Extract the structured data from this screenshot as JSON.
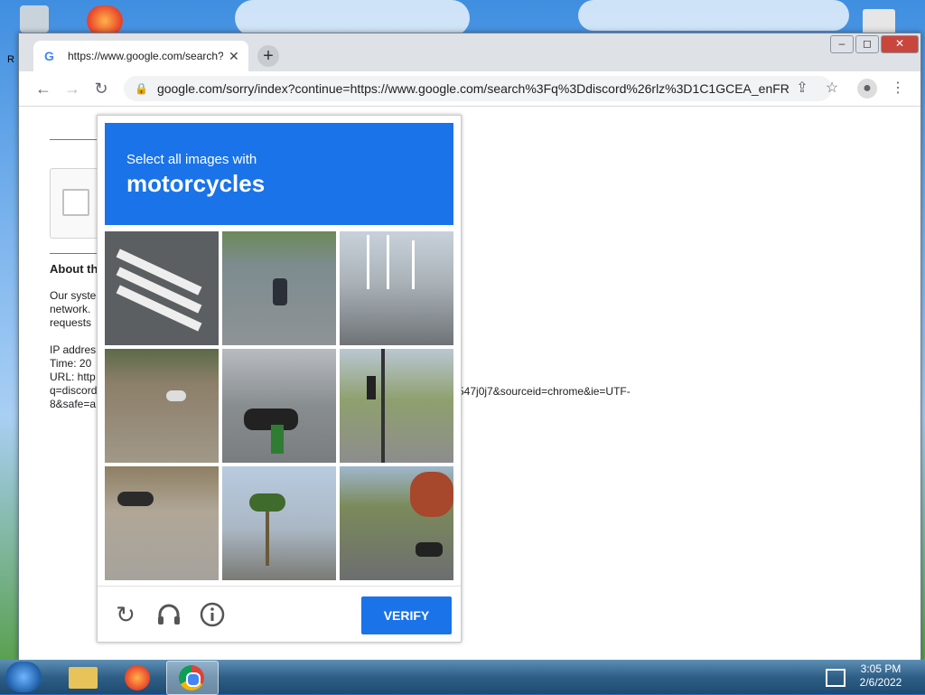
{
  "desktop": {
    "recycle_label": "R"
  },
  "browser": {
    "tab": {
      "title": "https://www.google.com/search?"
    },
    "new_tab_icon": "plus-icon",
    "window_controls": {
      "minimize": "–",
      "maximize": "◻",
      "close": "✕"
    },
    "address_bar": {
      "url": "google.com/sorry/index?continue=https://www.google.com/search%3Fq%3Ddiscord%26rlz%3D1C1GCEA_enFR..."
    }
  },
  "page": {
    "about_heading": "About th",
    "paragraph_lines": [
      "Our syste",
      "network.",
      "requests"
    ],
    "ip_line": "IP addres",
    "time_line": "Time: 20",
    "url_line": "URL: http",
    "q_line": "q=discord",
    "safe_line": "8&safe=a",
    "right_fragment_1": "547j0j7&sourceid=chrome&ie=UTF-",
    "right_fragment_2": ""
  },
  "captcha": {
    "instruction": "Select all images with",
    "target": "motorcycles",
    "verify_label": "VERIFY",
    "tiles": [
      "crosswalk",
      "motorcycle-road",
      "bridge",
      "dirt-lot",
      "parked-motorcycles",
      "traffic-light",
      "motorcycle-dirt",
      "palm-trees",
      "street"
    ]
  },
  "taskbar": {
    "time": "3:05 PM",
    "date": "2/6/2022"
  },
  "colors": {
    "accent": "#1a73e8"
  }
}
